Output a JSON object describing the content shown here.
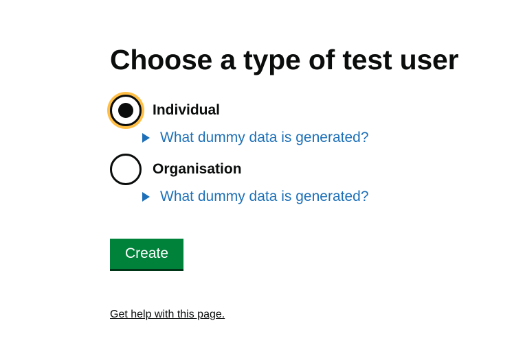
{
  "page": {
    "title": "Choose a type of test user"
  },
  "radios": [
    {
      "label": "Individual",
      "selected": true,
      "details_summary": "What dummy data is generated?"
    },
    {
      "label": "Organisation",
      "selected": false,
      "details_summary": "What dummy data is generated?"
    }
  ],
  "form": {
    "submit_label": "Create"
  },
  "footer": {
    "help_link": "Get help with this page."
  },
  "colors": {
    "text": "#0b0c0c",
    "link": "#1d70b8",
    "focus": "#ffbf47",
    "button_background": "#00823b",
    "button_shadow": "#003618"
  },
  "icons": {
    "details_toggle": "triangle-right-icon"
  }
}
